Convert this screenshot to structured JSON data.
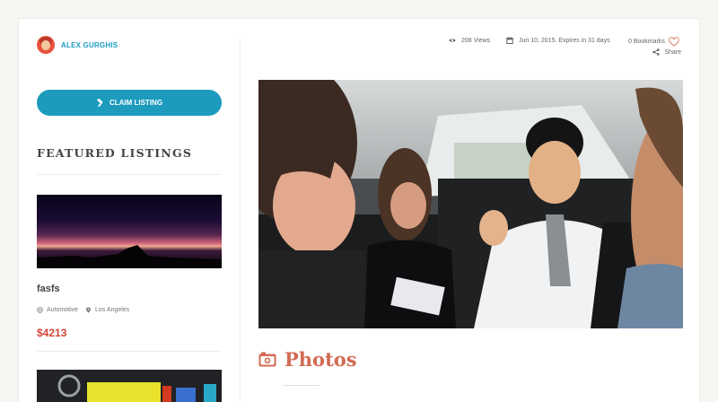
{
  "sidebar": {
    "author_name": "ALEX GURGHIS",
    "claim_label": "CLAIM LISTING",
    "featured_heading": "FEATURED LISTINGS",
    "listings": [
      {
        "title": "fasfs",
        "category": "Automotive",
        "location": "Los Angeles",
        "price": "$4213"
      }
    ]
  },
  "meta": {
    "views": "208 Views",
    "date": "Jun 10, 2015. Expires in 31 days",
    "bookmarks": "0 Bookmarks",
    "share": "Share"
  },
  "section": {
    "photos_title": "Photos"
  },
  "colors": {
    "accent_blue": "#1c9bbd",
    "price_red": "#d6453a",
    "heading_coral": "#d36b54"
  }
}
